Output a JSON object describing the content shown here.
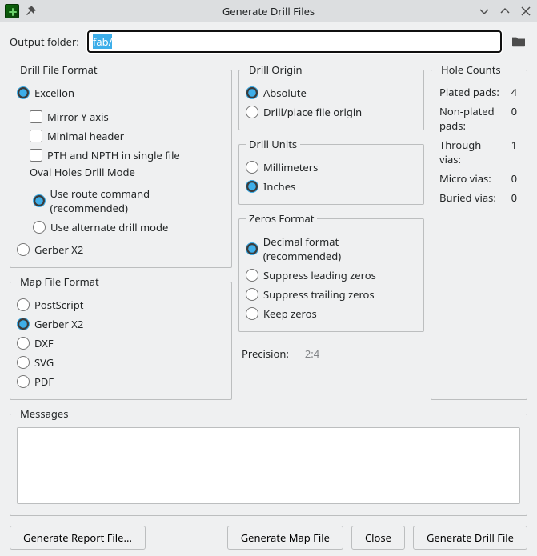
{
  "window": {
    "title": "Generate Drill Files"
  },
  "output": {
    "label": "Output folder:",
    "value": "fab/"
  },
  "drill_file_format": {
    "legend": "Drill File Format",
    "excellon_label": "Excellon",
    "mirror_label": "Mirror Y axis",
    "minimal_header_label": "Minimal header",
    "pth_npth_label": "PTH and NPTH in single file",
    "oval_title": "Oval Holes Drill Mode",
    "oval_route_label": "Use route command (recommended)",
    "oval_alt_label": "Use alternate drill mode",
    "gerber_label": "Gerber X2",
    "selected": "excellon",
    "mirror": false,
    "minimal_header": false,
    "pth_npth": false,
    "oval_mode": "route"
  },
  "map_file_format": {
    "legend": "Map File Format",
    "postscript_label": "PostScript",
    "gerber_label": "Gerber X2",
    "dxf_label": "DXF",
    "svg_label": "SVG",
    "pdf_label": "PDF",
    "selected": "gerberx2"
  },
  "drill_origin": {
    "legend": "Drill Origin",
    "absolute_label": "Absolute",
    "place_label": "Drill/place file origin",
    "selected": "absolute"
  },
  "drill_units": {
    "legend": "Drill Units",
    "mm_label": "Millimeters",
    "in_label": "Inches",
    "selected": "inches"
  },
  "zeros_format": {
    "legend": "Zeros Format",
    "decimal_label": "Decimal format (recommended)",
    "supp_lead_label": "Suppress leading zeros",
    "supp_trail_label": "Suppress trailing zeros",
    "keep_label": "Keep zeros",
    "selected": "decimal"
  },
  "precision": {
    "label": "Precision:",
    "value": "2:4"
  },
  "hole_counts": {
    "legend": "Hole Counts",
    "plated_label": "Plated pads:",
    "plated_value": "4",
    "nonplated_label": "Non-plated pads:",
    "nonplated_value": "0",
    "through_label": "Through vias:",
    "through_value": "1",
    "micro_label": "Micro vias:",
    "micro_value": "0",
    "buried_label": "Buried vias:",
    "buried_value": "0"
  },
  "messages": {
    "legend": "Messages",
    "text": ""
  },
  "buttons": {
    "report": "Generate Report File...",
    "map": "Generate Map File",
    "close": "Close",
    "drill": "Generate Drill File"
  }
}
